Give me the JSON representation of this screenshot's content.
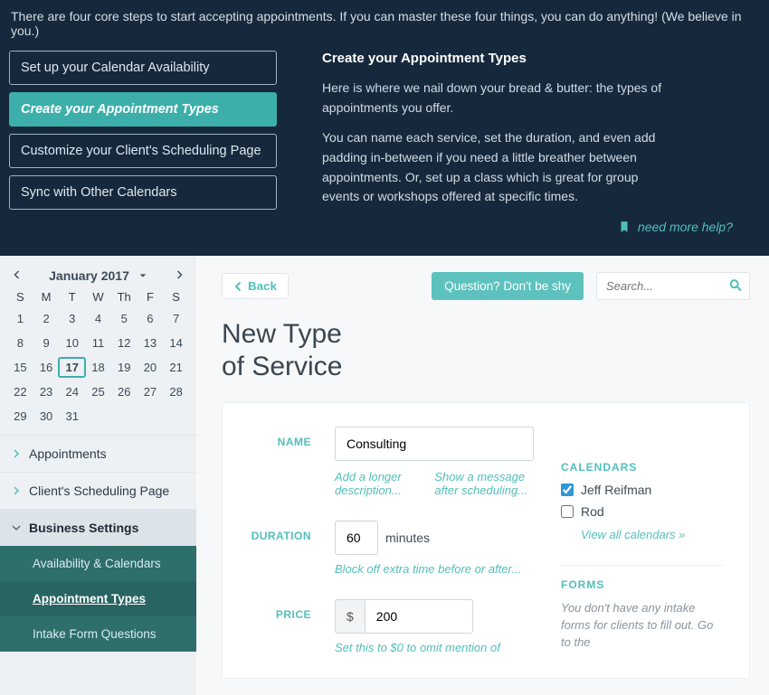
{
  "hero": {
    "intro": "There are four core steps to start accepting appointments. If you can master these four things, you can do anything! (We believe in you.)",
    "steps": [
      "Set up your Calendar Availability",
      "Create your Appointment Types",
      "Customize your Client's Scheduling Page",
      "Sync with Other Calendars"
    ],
    "active_step_index": 1,
    "right": {
      "title": "Create your Appointment Types",
      "p1": "Here is where we nail down your bread & butter: the types of appointments you offer.",
      "p2": "You can name each service, set the duration, and even add padding in-between if you need a little breather between appointments. Or, set up a class which is great for group events or workshops offered at specific times."
    },
    "help_link": "need more help?"
  },
  "calendar": {
    "title": "January 2017",
    "dow": [
      "S",
      "M",
      "T",
      "W",
      "Th",
      "F",
      "S"
    ],
    "days": [
      "1",
      "2",
      "3",
      "4",
      "5",
      "6",
      "7",
      "8",
      "9",
      "10",
      "11",
      "12",
      "13",
      "14",
      "15",
      "16",
      "17",
      "18",
      "19",
      "20",
      "21",
      "22",
      "23",
      "24",
      "25",
      "26",
      "27",
      "28",
      "29",
      "30",
      "31"
    ],
    "today": "17"
  },
  "sidebar": {
    "items": [
      "Appointments",
      "Client's Scheduling Page",
      "Business Settings"
    ],
    "sub_items": [
      "Availability & Calendars",
      "Appointment Types",
      "Intake Form Questions"
    ]
  },
  "content": {
    "back": "Back",
    "question_btn": "Question? Don't be shy",
    "search_placeholder": "Search...",
    "page_title_l1": "New Type",
    "page_title_l2": "of Service"
  },
  "form": {
    "name_label": "NAME",
    "name_value": "Consulting",
    "name_hint1": "Add a longer description...",
    "name_hint2": "Show a message after scheduling...",
    "duration_label": "DURATION",
    "duration_value": "60",
    "minutes": "minutes",
    "duration_hint": "Block off extra time before or after...",
    "price_label": "PRICE",
    "currency": "$",
    "price_value": "200",
    "price_hint": "Set this to $0 to omit mention of"
  },
  "side": {
    "calendars_heading": "CALENDARS",
    "cal1": "Jeff Reifman",
    "cal2": "Rod",
    "view_all": "View all calendars »",
    "forms_heading": "FORMS",
    "forms_text": "You don't have any intake forms for clients to fill out. Go to the"
  }
}
